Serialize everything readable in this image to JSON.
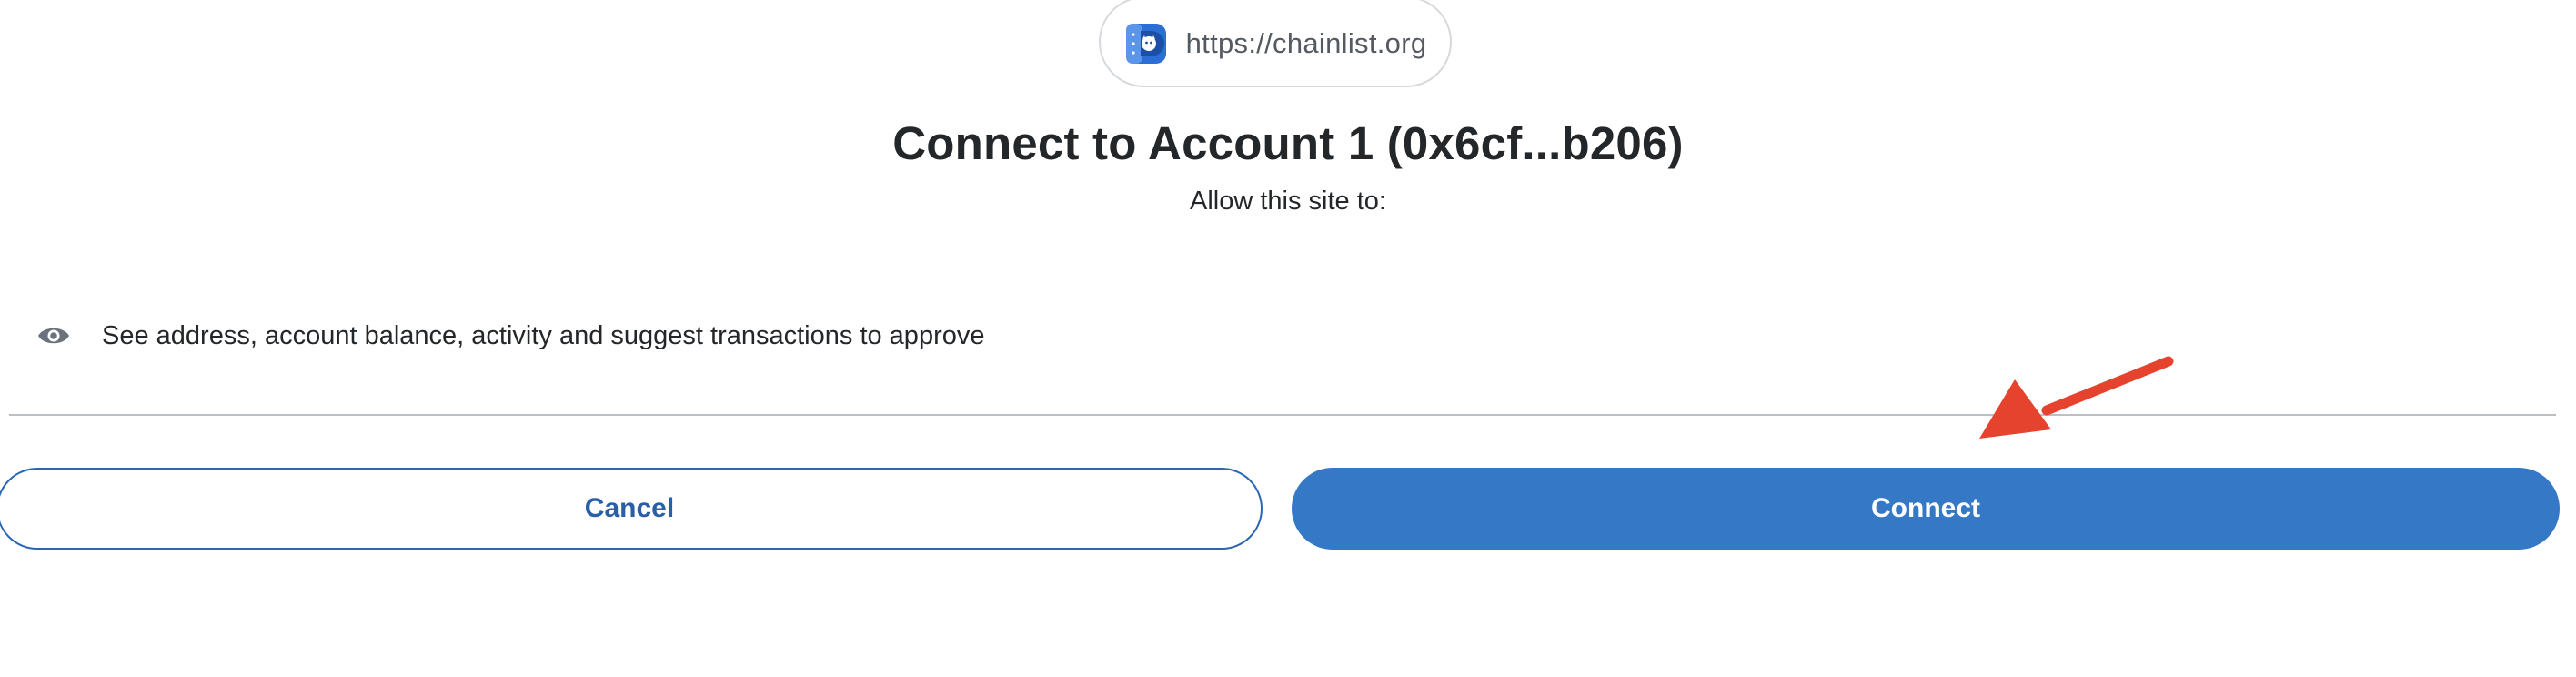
{
  "origin": {
    "url": "https://chainlist.org",
    "logo_icon": "chainlist-logo-icon"
  },
  "header": {
    "title": "Connect to Account 1 (0x6cf...b206)",
    "subtitle": "Allow this site to:"
  },
  "permissions": [
    {
      "icon": "eye-icon",
      "text": "See address, account balance, activity and suggest transactions to approve"
    }
  ],
  "actions": {
    "cancel_label": "Cancel",
    "connect_label": "Connect"
  },
  "colors": {
    "primary": "#3478c6",
    "primary_text": "#2a5fa8",
    "annotation": "#e5432e",
    "divider": "#bbc0c5"
  }
}
